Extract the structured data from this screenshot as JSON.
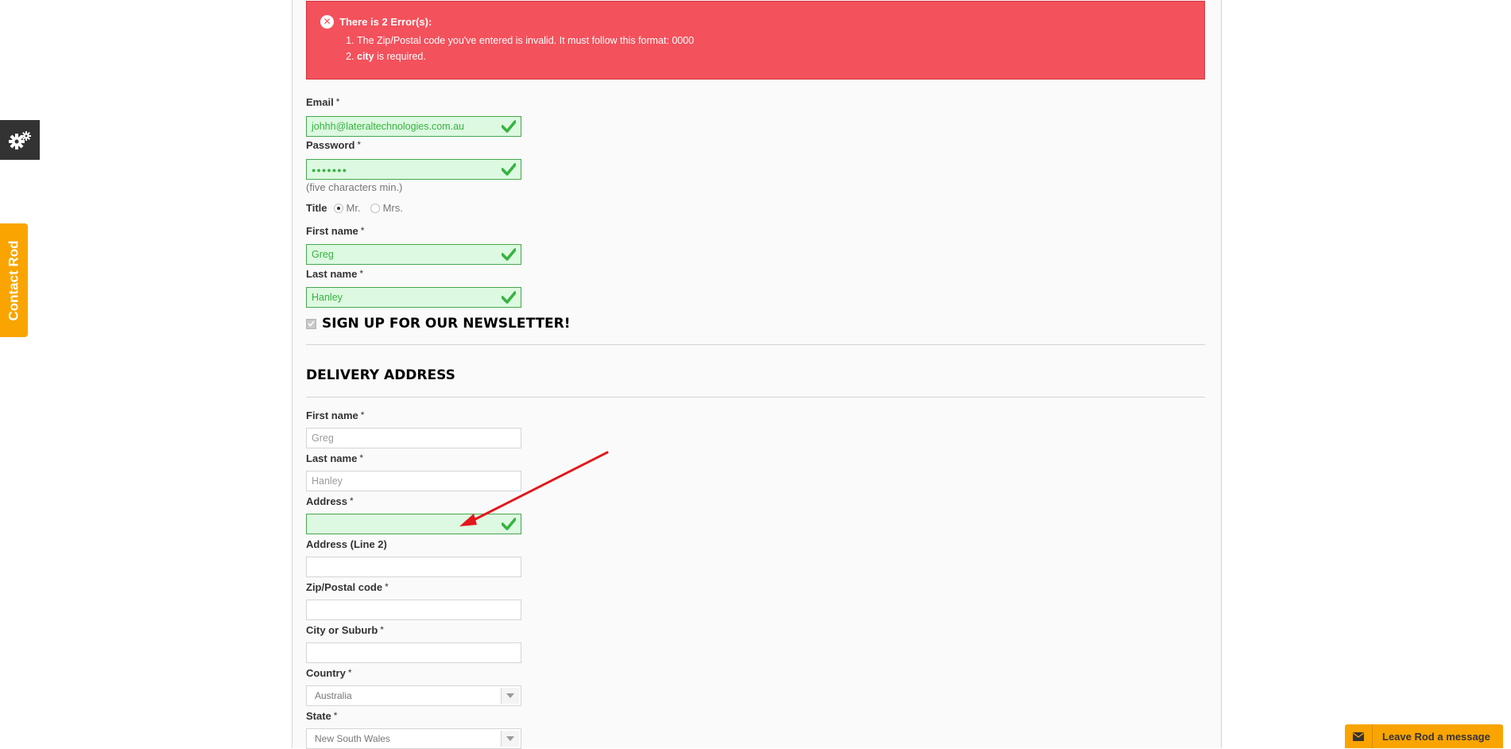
{
  "errors": {
    "heading": "There is 2 Error(s):",
    "item1": "The Zip/Postal code you've entered is invalid. It must follow this format: 0000",
    "item2_bold": "city",
    "item2_rest": " is required."
  },
  "account": {
    "email_label": "Email",
    "email_value": "johhh@lateraltechnologies.com.au",
    "password_label": "Password",
    "password_value": "●●●●●●●",
    "password_hint": "(five characters min.)",
    "title_label": "Title",
    "title_mr": "Mr.",
    "title_mrs": "Mrs.",
    "firstname_label": "First name",
    "firstname_value": "Greg",
    "lastname_label": "Last name",
    "lastname_value": "Hanley",
    "newsletter_label": "SIGN UP FOR OUR NEWSLETTER!"
  },
  "delivery": {
    "section_title": "DELIVERY ADDRESS",
    "firstname_label": "First name",
    "firstname_value": "Greg",
    "lastname_label": "Last name",
    "lastname_value": "Hanley",
    "address_label": "Address",
    "address_value": "",
    "address2_label": "Address (Line 2)",
    "zip_label": "Zip/Postal code",
    "city_label": "City or Suburb",
    "country_label": "Country",
    "country_value": "Australia",
    "state_label": "State",
    "state_value": "New South Wales"
  },
  "required_marker": "*",
  "side": {
    "contact_tab": "Contact Rod",
    "message_tab": "Leave Rod a message"
  },
  "colors": {
    "error_bg": "#f3515c",
    "valid_bg": "#ddf9e1",
    "valid_border": "#46a74e",
    "accent_orange": "#f9a400",
    "annotation_arrow": "#e3161b"
  }
}
